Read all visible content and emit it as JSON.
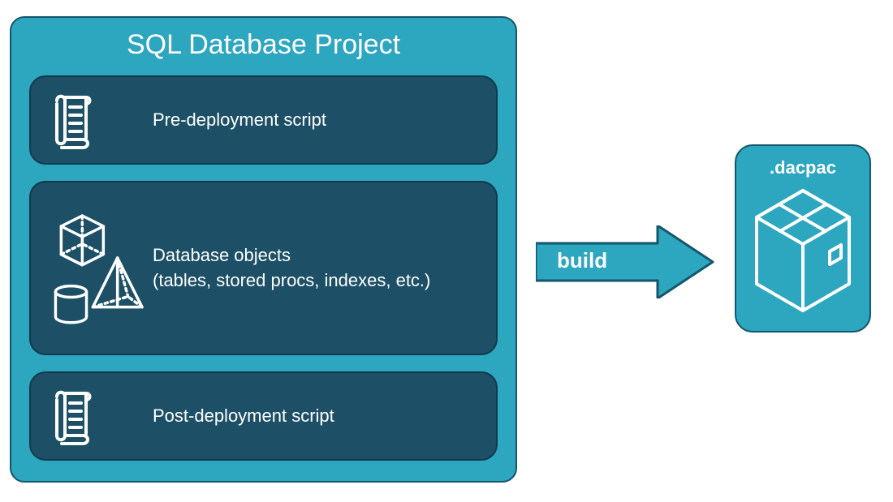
{
  "project": {
    "title": "SQL Database Project",
    "sections": [
      {
        "id": "pre",
        "label": "Pre-deployment script"
      },
      {
        "id": "objs",
        "label_line1": "Database objects",
        "label_line2": "(tables, stored procs, indexes, etc.)"
      },
      {
        "id": "post",
        "label": "Post-deployment script"
      }
    ]
  },
  "arrow": {
    "label": "build"
  },
  "output": {
    "label": ".dacpac"
  },
  "colors": {
    "outer_bg": "#2da6bf",
    "outer_border": "#14566b",
    "inner_bg": "#1d5066",
    "inner_border": "#0f3a4c",
    "text": "#ffffff"
  }
}
